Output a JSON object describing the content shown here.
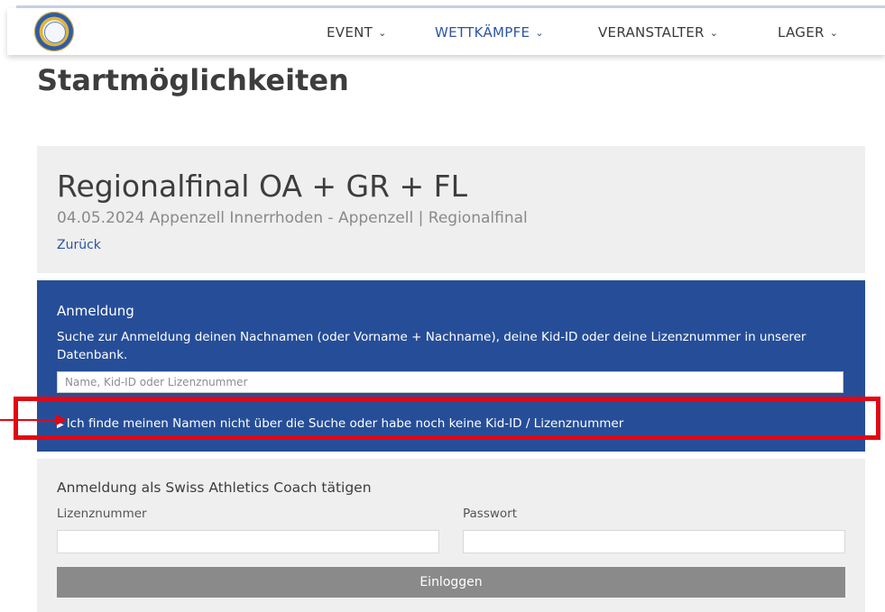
{
  "nav": {
    "items": [
      {
        "label": "EVENT",
        "active": false
      },
      {
        "label": "WETTKÄMPFE",
        "active": true
      },
      {
        "label": "VERANSTALTER",
        "active": false
      },
      {
        "label": "LAGER",
        "active": false
      }
    ],
    "chevron": "⌄",
    "logo_icon": "club-logo-icon"
  },
  "page": {
    "title": "Startmöglichkeiten"
  },
  "event": {
    "title": "Regionalfinal OA + GR + FL",
    "subtitle": "04.05.2024 Appenzell Innerrhoden - Appenzell | Regionalfinal",
    "back_label": "Zurück"
  },
  "registration": {
    "title": "Anmeldung",
    "description": "Suche zur Anmeldung deinen Nachnamen (oder Vorname + Nachname), deine Kid-ID oder deine Lizenznummer in unserer Datenbank.",
    "search_placeholder": "Name, Kid-ID oder Lizenznummer",
    "not_found_label": "Ich finde meinen Namen nicht über die Suche oder habe noch keine Kid-ID / Lizenznummer"
  },
  "coach": {
    "title": "Anmeldung als Swiss Athletics Coach tätigen",
    "license_label": "Lizenznummer",
    "password_label": "Passwort",
    "login_label": "Einloggen"
  },
  "colors": {
    "brand_blue": "#264e98",
    "link_blue": "#2c55a0",
    "highlight_red": "#e30613",
    "button_gray": "#8a8a8a"
  }
}
